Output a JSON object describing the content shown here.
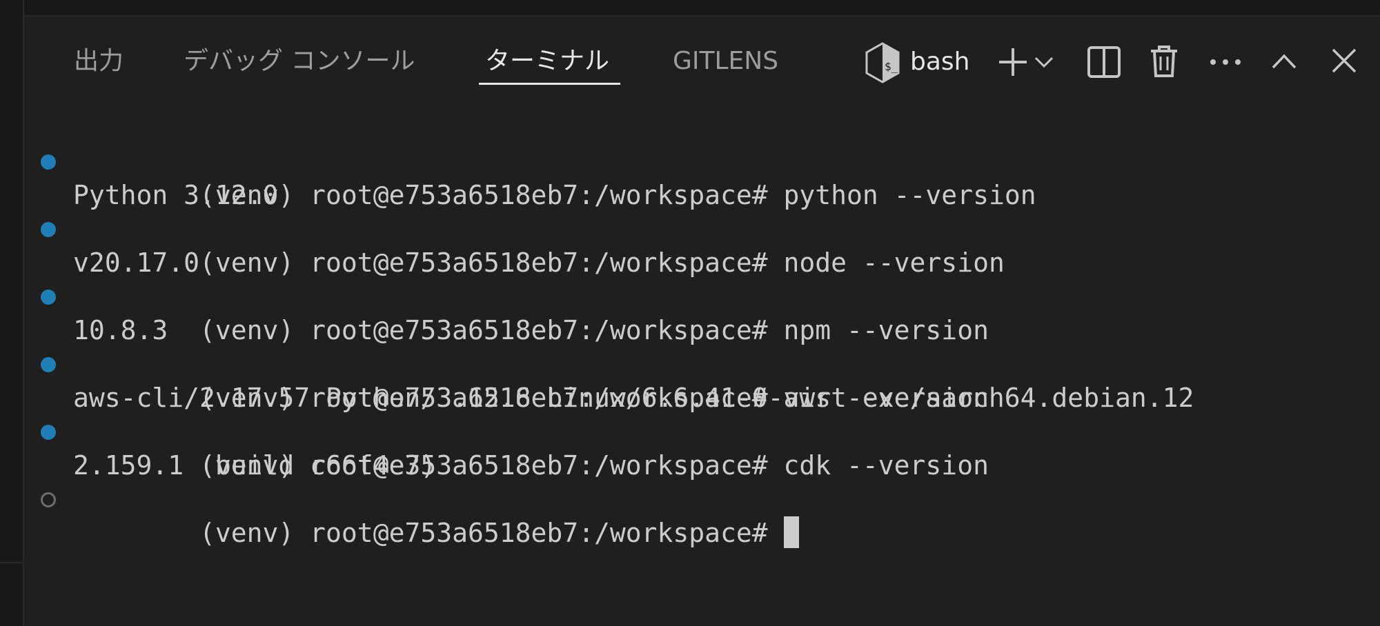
{
  "panel": {
    "tabs": [
      {
        "label": "出力",
        "active": false
      },
      {
        "label": "デバッグ コンソール",
        "active": false
      },
      {
        "label": "ターミナル",
        "active": true
      },
      {
        "label": "GITLENS",
        "active": false
      }
    ],
    "shell_label": "bash",
    "icons": [
      "bash-shell-icon",
      "add-icon",
      "chevron-down-icon",
      "split-icon",
      "trash-icon",
      "more-icon",
      "chevron-up-icon",
      "close-icon"
    ]
  },
  "terminal": {
    "lines": [
      {
        "kind": "command",
        "status": "success",
        "prompt": "(venv) root@e753a6518eb7:/workspace#",
        "command": "python --version"
      },
      {
        "kind": "output",
        "text": "Python 3.12.0"
      },
      {
        "kind": "command",
        "status": "success",
        "prompt": "(venv) root@e753a6518eb7:/workspace#",
        "command": "node --version"
      },
      {
        "kind": "output",
        "text": "v20.17.0"
      },
      {
        "kind": "command",
        "status": "success",
        "prompt": "(venv) root@e753a6518eb7:/workspace#",
        "command": "npm --version"
      },
      {
        "kind": "output",
        "text": "10.8.3"
      },
      {
        "kind": "command",
        "status": "success",
        "prompt": "(venv) root@e753a6518eb7:/workspace#",
        "command": "aws --version"
      },
      {
        "kind": "output",
        "text": "aws-cli/2.17.57 Python/3.12.6 Linux/6.6.41-0-virt exe/aarch64.debian.12"
      },
      {
        "kind": "command",
        "status": "success",
        "prompt": "(venv) root@e753a6518eb7:/workspace#",
        "command": "cdk --version"
      },
      {
        "kind": "output",
        "text": "2.159.1 (build c66f4e3)"
      },
      {
        "kind": "prompt",
        "status": "pending",
        "prompt": "(venv) root@e753a6518eb7:/workspace#",
        "command": ""
      }
    ]
  },
  "colors": {
    "background": "#1f1f1f",
    "success_dot": "#1f7fb6",
    "active_tab": "#e7e7e7",
    "inactive_tab": "#9d9d9d",
    "terminal_text": "#cccccc"
  }
}
